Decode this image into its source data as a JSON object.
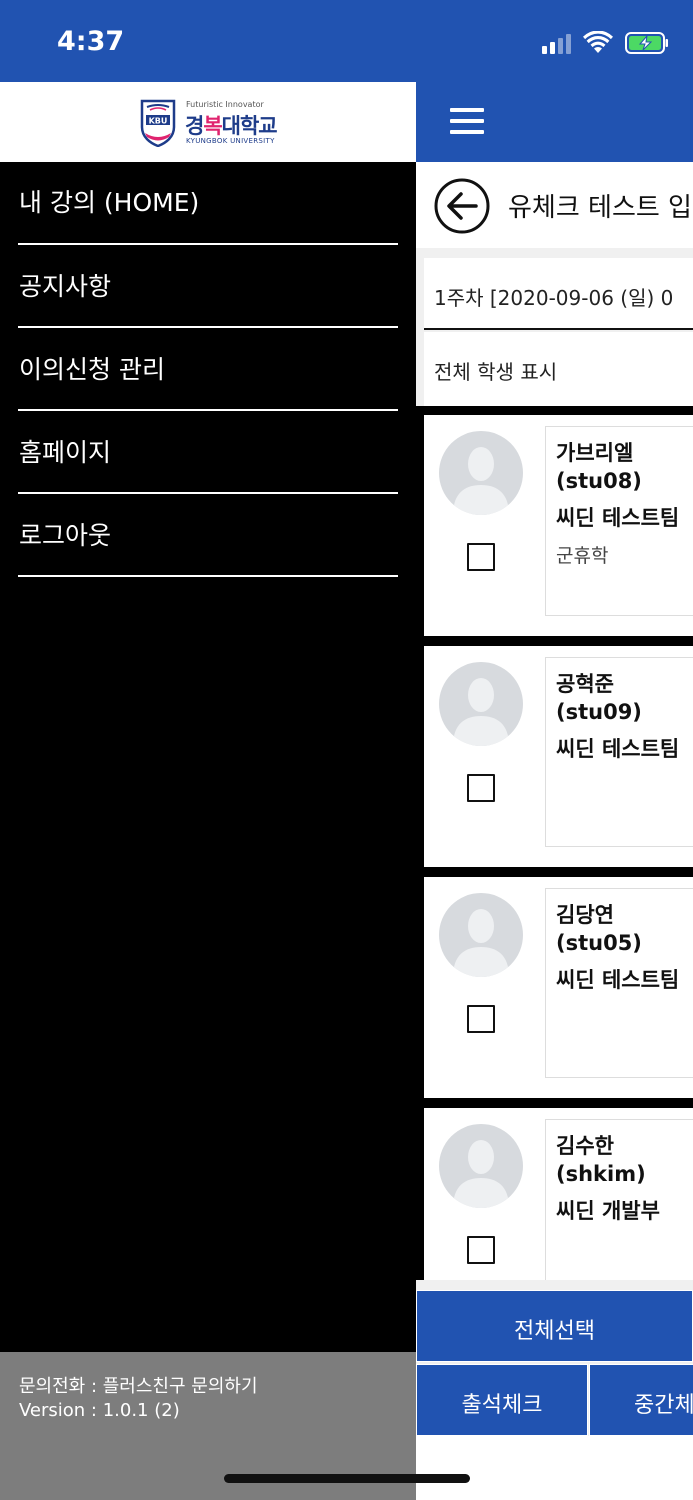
{
  "status_bar": {
    "time": "4:37",
    "battery_color": "#4cd964"
  },
  "drawer": {
    "logo": {
      "tagline": "Futuristic Innovator",
      "name_kr_part1": "경",
      "name_kr_part2": "복",
      "name_kr_part3": "대학교",
      "name_en": "KYUNGBOK UNIVERSITY"
    },
    "menu": [
      {
        "label": "내 강의 (HOME)"
      },
      {
        "label": "공지사항"
      },
      {
        "label": "이의신청 관리"
      },
      {
        "label": "홈페이지"
      },
      {
        "label": "로그아웃"
      }
    ],
    "footer": {
      "contact": "문의전화 :  플러스친구 문의하기",
      "version": "Version :  1.0.1 (2)"
    }
  },
  "app": {
    "title": "유체크 테스트 입",
    "week": "1주차 [2020-09-06 (일) 0",
    "filter": "전체 학생 표시",
    "students": [
      {
        "name": "가브리엘",
        "id": "(stu08)",
        "team": "씨딘 테스트팀",
        "status": "군휴학"
      },
      {
        "name": "공혁준",
        "id": "(stu09)",
        "team": "씨딘 테스트팀",
        "status": ""
      },
      {
        "name": "김당연",
        "id": "(stu05)",
        "team": "씨딘 테스트팀",
        "status": ""
      },
      {
        "name": "김수한",
        "id": "(shkim)",
        "team": "씨딘 개발부",
        "status": ""
      }
    ],
    "buttons": {
      "select_all": "전체선택",
      "attendance": "출석체크",
      "mid": "중간체"
    },
    "colors": {
      "primary": "#2153b1"
    }
  }
}
